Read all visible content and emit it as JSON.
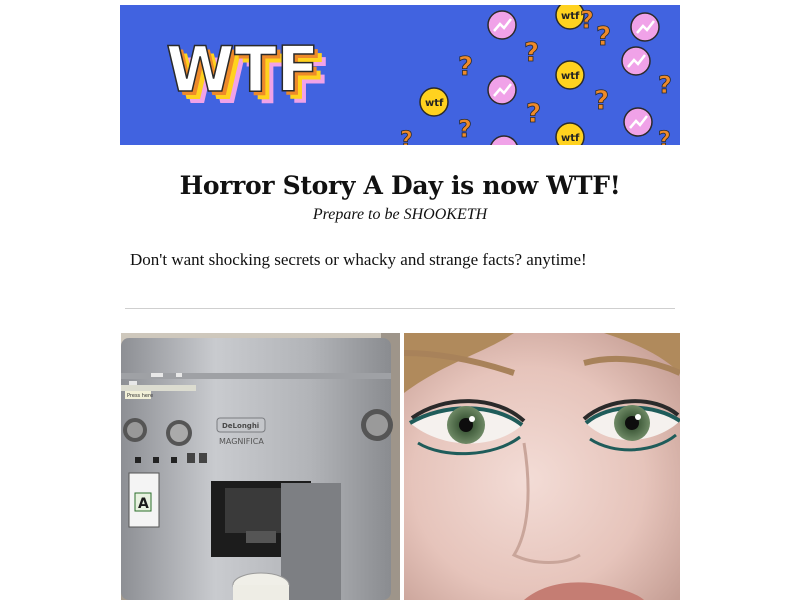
{
  "banner": {
    "logo_text": "WTF",
    "pattern_icons": [
      "wtf-badge",
      "question-mark",
      "trend-up-icon"
    ],
    "pattern_badge_text": "wtf",
    "colors": {
      "background": "#4163e0",
      "orange": "#ee8a2a",
      "yellow": "#ffd21f",
      "pink": "#f0a2e8"
    }
  },
  "header": {
    "title": "Horror Story A Day is now WTF!",
    "subtitle": "Prepare to be SHOOKETH"
  },
  "body": {
    "intro": "Don't want shocking secrets or whacky and strange facts? anytime!"
  },
  "images": [
    {
      "name": "coffee-machine-photo",
      "brand_text": "DeLonghi",
      "model_text": "MAGNIFICA",
      "label_text": "Press here",
      "energy_class": "A"
    },
    {
      "name": "face-closeup-photo"
    }
  ]
}
